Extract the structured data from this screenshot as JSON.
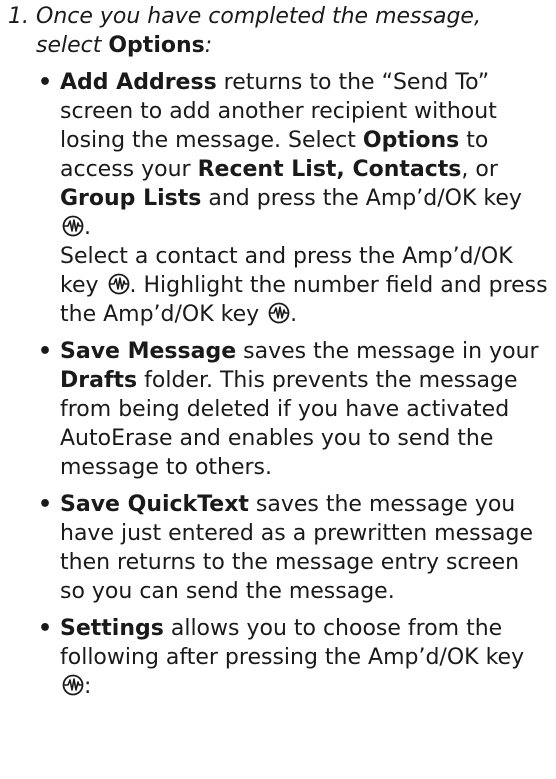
{
  "step": {
    "number": "1.",
    "intro": "Once you have completed the message, select ",
    "options_label": "Options",
    "colon": ":"
  },
  "bullets": [
    {
      "term": "Add Address",
      "text1": " returns to the “Send To” screen to add another recipient without losing the message. Select ",
      "b1": "Options",
      "text2": " to access your ",
      "b2": "Recent List, Contacts",
      "text3": ", or ",
      "b3": "Group Lists",
      "text4": " and press the Amp’d/OK key ",
      "text5": ".",
      "text6": "Select a contact and press the Amp’d/OK key ",
      "text7": ". Highlight the number field and press the Amp’d/OK key ",
      "text8": "."
    },
    {
      "term": "Save Message",
      "text1": " saves the message in your ",
      "b1": "Drafts",
      "text2": " folder. This prevents the message from being deleted if you have activated AutoErase and enables you to send the message to others."
    },
    {
      "term": "Save QuickText",
      "text1": " saves the message you have just entered as a prewritten message then returns to the message entry screen so you can send the message."
    },
    {
      "term": "Settings",
      "text1": " allows you to choose from the following after pressing the Amp’d/OK key ",
      "text2": ":"
    }
  ],
  "bullet_glyph": "•",
  "icons": {
    "ok_key": "amp-ok-key-icon"
  }
}
